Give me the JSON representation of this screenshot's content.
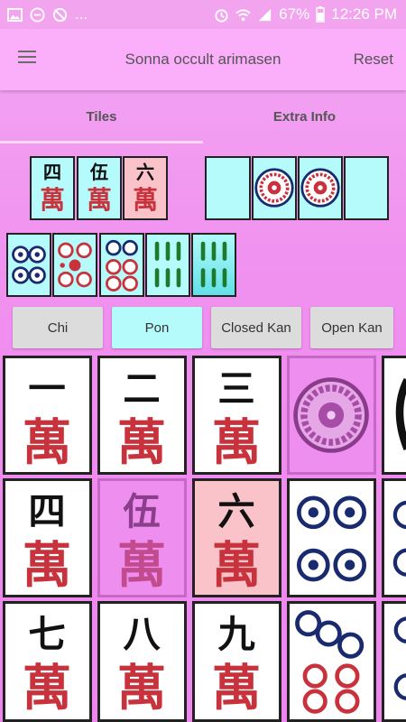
{
  "status_bar": {
    "dots": "...",
    "battery": "67%",
    "time": "12:26 PM",
    "icons": [
      "image-icon",
      "dnd-icon",
      "no-rotate-icon",
      "alarm-icon",
      "wifi-icon",
      "signal-icon",
      "battery-icon"
    ]
  },
  "appbar": {
    "title": "Sonna occult arimasen",
    "reset_label": "Reset",
    "menu_icon": "hamburger-menu-icon"
  },
  "tabs": [
    {
      "label": "Tiles",
      "selected": true
    },
    {
      "label": "Extra Info",
      "selected": false
    }
  ],
  "hand_characters": [
    "四",
    "伍",
    "六"
  ],
  "wan": "萬",
  "buttons": {
    "chi": "Chi",
    "pon": "Pon",
    "closed_kan": "Closed Kan",
    "open_kan": "Open Kan"
  },
  "colors": {
    "accent": "#fbaef9",
    "tile_cyan": "#b5fbfb",
    "tile_pink": "#f9c3c9",
    "wan_red": "#c8323c",
    "selected": "#ee8fef"
  },
  "grid": {
    "row1": [
      "一",
      "二",
      "三"
    ],
    "row2": [
      "四",
      "伍",
      "六"
    ],
    "row3": [
      "七",
      "八",
      "九"
    ]
  }
}
